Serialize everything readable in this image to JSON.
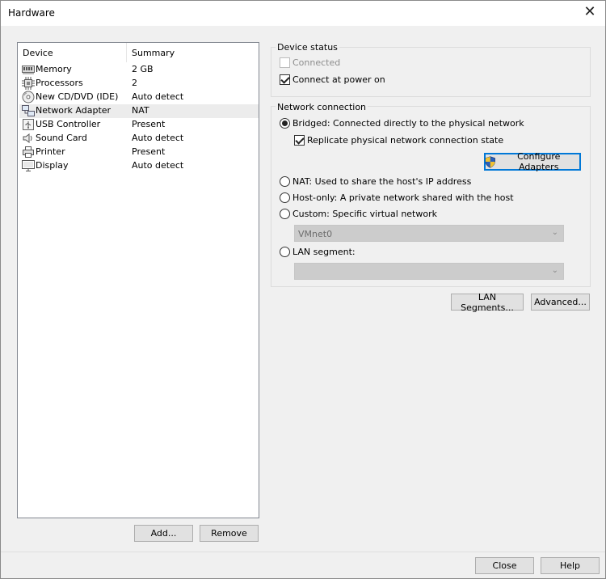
{
  "window": {
    "title": "Hardware",
    "close_glyph": "✕"
  },
  "device_list": {
    "headers": {
      "device": "Device",
      "summary": "Summary"
    },
    "items": [
      {
        "icon": "memory-icon",
        "name": "Memory",
        "summary": "2 GB"
      },
      {
        "icon": "processor-icon",
        "name": "Processors",
        "summary": "2"
      },
      {
        "icon": "cd-dvd-icon",
        "name": "New CD/DVD (IDE)",
        "summary": "Auto detect"
      },
      {
        "icon": "network-adapter-icon",
        "name": "Network Adapter",
        "summary": "NAT"
      },
      {
        "icon": "usb-icon",
        "name": "USB Controller",
        "summary": "Present"
      },
      {
        "icon": "speaker-icon",
        "name": "Sound Card",
        "summary": "Auto detect"
      },
      {
        "icon": "printer-icon",
        "name": "Printer",
        "summary": "Present"
      },
      {
        "icon": "monitor-icon",
        "name": "Display",
        "summary": "Auto detect"
      }
    ],
    "selected_index": 3
  },
  "buttons": {
    "add": "Add...",
    "remove": "Remove",
    "configure_adapters": "Configure Adapters",
    "lan_segments": "LAN Segments...",
    "advanced": "Advanced...",
    "close": "Close",
    "help": "Help"
  },
  "device_status": {
    "title": "Device status",
    "connected": {
      "label": "Connected",
      "checked": false,
      "disabled": true
    },
    "connect_at_power_on": {
      "label": "Connect at power on",
      "checked": true
    }
  },
  "network_connection": {
    "title": "Network connection",
    "bridged": {
      "label": "Bridged: Connected directly to the physical network",
      "selected": true
    },
    "replicate": {
      "label": "Replicate physical network connection state",
      "checked": true
    },
    "nat": {
      "label": "NAT: Used to share the host's IP address"
    },
    "host_only": {
      "label": "Host-only: A private network shared with the host"
    },
    "custom": {
      "label": "Custom: Specific virtual network"
    },
    "custom_network_value": "VMnet0",
    "lan_segment": {
      "label": "LAN segment:"
    },
    "lan_segment_value": ""
  },
  "colors": {
    "focus_border": "#0078d7",
    "selection": "#ececec",
    "dialog_bg": "#f0f0f0"
  }
}
